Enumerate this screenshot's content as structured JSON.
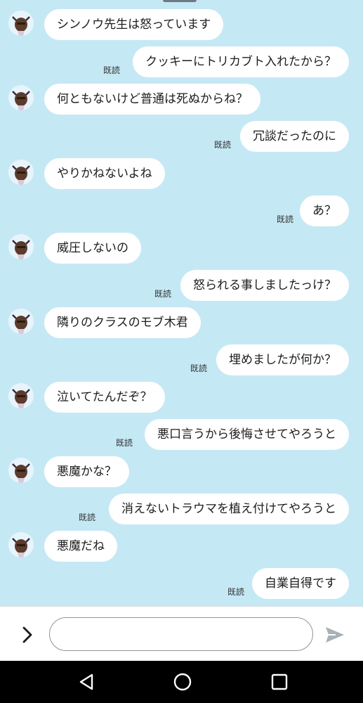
{
  "colors": {
    "background": "#c5e8f5",
    "bubble": "#ffffff",
    "navbar": "#000000",
    "send_icon": "#a8b1b7"
  },
  "messages": [
    {
      "side": "left",
      "text": "シンノウ先生は怒っています"
    },
    {
      "side": "right",
      "text": "クッキーにトリカブト入れたから？",
      "read": "既読"
    },
    {
      "side": "left",
      "text": "何ともないけど普通は死ぬからね？"
    },
    {
      "side": "right",
      "text": "冗談だったのに",
      "read": "既読"
    },
    {
      "side": "left",
      "text": "やりかねないよね"
    },
    {
      "side": "right",
      "text": "あ？",
      "read": "既読"
    },
    {
      "side": "left",
      "text": "威圧しないの"
    },
    {
      "side": "right",
      "text": "怒られる事しましたっけ？",
      "read": "既読"
    },
    {
      "side": "left",
      "text": "隣りのクラスのモブ木君"
    },
    {
      "side": "right",
      "text": "埋めましたが何か？",
      "read": "既読"
    },
    {
      "side": "left",
      "text": "泣いてたんだぞ？"
    },
    {
      "side": "right",
      "text": "悪口言うから後悔させてやろうと",
      "read": "既読"
    },
    {
      "side": "left",
      "text": "悪魔かな？"
    },
    {
      "side": "right",
      "text": "消えないトラウマを植え付けてやろうと",
      "read": "既読"
    },
    {
      "side": "left",
      "text": "悪魔だね"
    },
    {
      "side": "right",
      "text": "自業自得です",
      "read": "既読"
    }
  ],
  "input": {
    "placeholder": "",
    "value": "",
    "expand_icon": "chevron-right-icon",
    "send_icon": "send-icon"
  },
  "navbar": {
    "back_icon": "back-triangle-icon",
    "home_icon": "home-circle-icon",
    "recents_icon": "recents-square-icon"
  }
}
